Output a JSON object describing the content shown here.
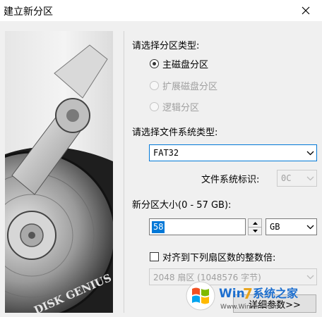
{
  "window": {
    "title": "建立新分区",
    "close_icon": "close-icon"
  },
  "artwork": {
    "brand_text": "DISK GENIUS"
  },
  "partition_type": {
    "label": "请选择分区类型:",
    "options": [
      {
        "label": "主磁盘分区",
        "checked": true,
        "enabled": true
      },
      {
        "label": "扩展磁盘分区",
        "checked": false,
        "enabled": false
      },
      {
        "label": "逻辑分区",
        "checked": false,
        "enabled": false
      }
    ]
  },
  "filesystem": {
    "label": "请选择文件系统类型:",
    "selected": "FAT32"
  },
  "fs_id": {
    "label": "文件系统标识:",
    "value": "0C"
  },
  "size": {
    "label": "新分区大小(0 - 57 GB):",
    "value": "58",
    "unit": "GB"
  },
  "align": {
    "label": "对齐到下列扇区数的整数倍:",
    "checked": false,
    "selected": "2048 扇区 (1048576 字节)"
  },
  "details_button": "详细参数>>",
  "watermark": {
    "brand_w": "Win",
    "brand_7": "7",
    "site_name": "系统之家",
    "url": "Www.Winwin7.com"
  }
}
